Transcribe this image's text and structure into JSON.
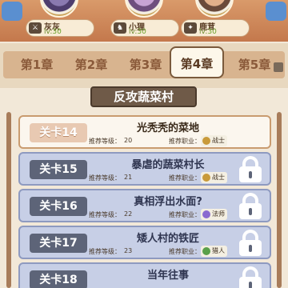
{
  "heroes": [
    {
      "name": "灰灰",
      "lv_label": "lv:",
      "lv": "30"
    },
    {
      "name": "小狸",
      "lv_label": "lv:",
      "lv": "30"
    },
    {
      "name": "鹿茸",
      "lv_label": "lv:",
      "lv": "30"
    }
  ],
  "chapters": [
    "第1章",
    "第2章",
    "第3章",
    "第4章",
    "第5章"
  ],
  "active_chapter": "第4章",
  "stage_title": "反攻蔬菜村",
  "meta_labels": {
    "rec_level": "推荐等级：",
    "rec_job": "推荐职业："
  },
  "levels": [
    {
      "label": "关卡14",
      "name": "光秃秃的菜地",
      "rec_level": "20",
      "job": "战士",
      "locked": false
    },
    {
      "label": "关卡15",
      "name": "暴虐的蔬菜村长",
      "rec_level": "21",
      "job": "战士",
      "locked": true
    },
    {
      "label": "关卡16",
      "name": "真相浮出水面?",
      "rec_level": "22",
      "job": "法师",
      "locked": true
    },
    {
      "label": "关卡17",
      "name": "矮人村的铁匠",
      "rec_level": "23",
      "job": "猎人",
      "locked": true
    },
    {
      "label": "关卡18",
      "name": "当年往事",
      "rec_level": "",
      "job": "",
      "locked": true
    }
  ],
  "colors": {
    "open_bg": "#fbf6ee",
    "locked_bg": "#c7cfe6",
    "title_bg": "#6f5a48"
  }
}
